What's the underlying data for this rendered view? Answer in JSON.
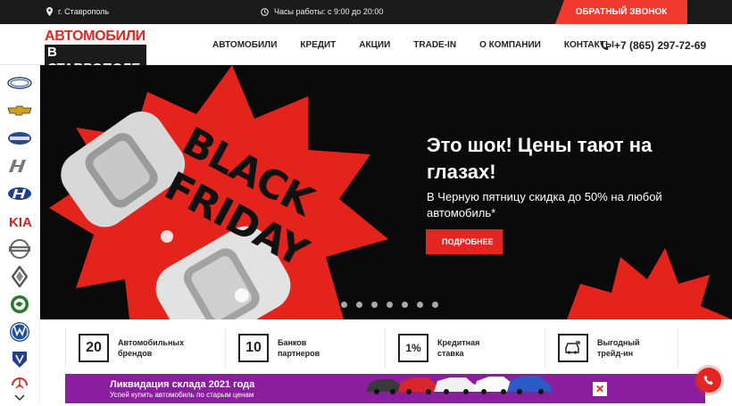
{
  "topbar": {
    "city": "г. Ставрополь",
    "hours": "Часы работы: с 9:00 до 20:00",
    "callback_label": "ОБРАТНЫЙ ЗВОНОК"
  },
  "header": {
    "logo_line1": "АВТОМОБИЛИ",
    "logo_line2": "В СТАВРОПОЛЕ",
    "phone": "+7 (865) 297-72-69",
    "nav": [
      "АВТОМОБИЛИ",
      "КРЕДИТ",
      "АКЦИИ",
      "TRADE-IN",
      "О КОМПАНИИ",
      "КОНТАКТЫ"
    ]
  },
  "brands": [
    "Ford",
    "Chevrolet",
    "Datsun",
    "Hyundai-H",
    "Hyundai",
    "KIA",
    "Nissan",
    "Renault",
    "Skoda",
    "Volkswagen",
    "Ravon",
    "Chery"
  ],
  "hero": {
    "banner_text_1": "BLACK",
    "banner_text_2": "FRIDAY",
    "title": "Это шок! Цены тают на глазах!",
    "subtitle": "В Черную пятницу скидка до 50% на любой автомобиль*",
    "button_label": "ПОДРОБНЕЕ",
    "slides_total": 8,
    "active_slide": 1
  },
  "features": [
    {
      "value": "20",
      "label": "Автомобильных брендов"
    },
    {
      "value": "10",
      "label": "Банков партнеров"
    },
    {
      "value": "1%",
      "label": "Кредитная ставка"
    },
    {
      "value": "",
      "label": "Выгодный трейд-ин"
    }
  ],
  "promo": {
    "title": "Ликвидация склада 2021 года",
    "subtitle": "Успей купить автомобиль по старым ценам",
    "close_label": "✕"
  },
  "colors": {
    "accent": "#e42622",
    "dark": "#1b1b1b",
    "promo": "#8b1e9e"
  }
}
